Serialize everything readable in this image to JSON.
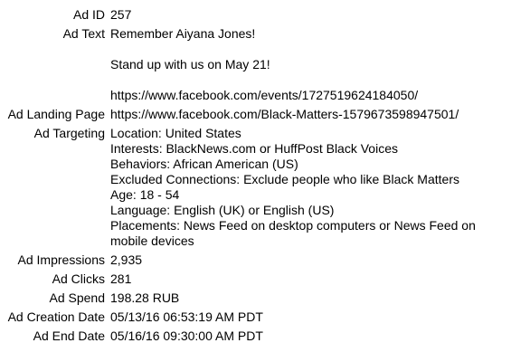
{
  "ad": {
    "id_label": "Ad ID",
    "id": "257",
    "text_label": "Ad Text",
    "text_lines": [
      "Remember Aiyana Jones!",
      "Stand up with us on May 21!",
      "https://www.facebook.com/events/1727519624184050/"
    ],
    "landing_label": "Ad Landing Page",
    "landing_url": "https://www.facebook.com/Black-Matters-1579673598947501/",
    "targeting_label": "Ad Targeting",
    "targeting": {
      "location": "Location: United States",
      "interests": "Interests: BlackNews.com or HuffPost Black Voices",
      "behaviors": "Behaviors: African American (US)",
      "excluded": "Excluded Connections: Exclude people who like Black Matters",
      "age": "Age: 18 - 54",
      "language": "Language: English (UK) or English (US)",
      "placements": "Placements: News Feed on desktop computers or News Feed on mobile devices"
    },
    "impressions_label": "Ad Impressions",
    "impressions": "2,935",
    "clicks_label": "Ad Clicks",
    "clicks": "281",
    "spend_label": "Ad Spend",
    "spend": "198.28 RUB",
    "creation_label": "Ad Creation Date",
    "creation_date": "05/13/16 06:53:19 AM PDT",
    "end_label": "Ad End Date",
    "end_date": "05/16/16 09:30:00 AM PDT"
  }
}
